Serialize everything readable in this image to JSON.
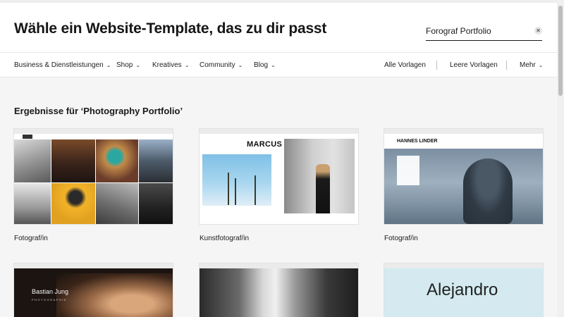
{
  "header": {
    "title": "Wähle ein Website-Template, das zu dir passt",
    "search": {
      "value": "Forograf Portfolio",
      "placeholder": ""
    },
    "clear_symbol": "✕"
  },
  "nav": {
    "categories": [
      {
        "label": "Business & Dienstleistungen"
      },
      {
        "label": "Shop"
      },
      {
        "label": "Kreatives"
      },
      {
        "label": "Community"
      },
      {
        "label": "Blog"
      }
    ],
    "right": [
      {
        "label": "Alle Vorlagen"
      },
      {
        "label": "Leere Vorlagen"
      },
      {
        "label": "Mehr"
      }
    ],
    "chevron": "⌄"
  },
  "results": {
    "heading": "Ergebnisse für ‘Photography Portfolio’",
    "cards": [
      {
        "label": "Fotograf/in"
      },
      {
        "label": "Kunstfotograf/in",
        "preview_name": "MARCUS BERG"
      },
      {
        "label": "Fotograf/in",
        "preview_name": "HANNES LINDER"
      },
      {
        "label": "",
        "preview_name": "Bastian Jung",
        "preview_sub": "PHOTOGRAPHIE"
      },
      {
        "label": ""
      },
      {
        "label": "",
        "preview_name": "Alejandro"
      }
    ]
  },
  "colors": {
    "background": "#f5f5f5",
    "accent_blue_preview": "#d4eaf0"
  }
}
